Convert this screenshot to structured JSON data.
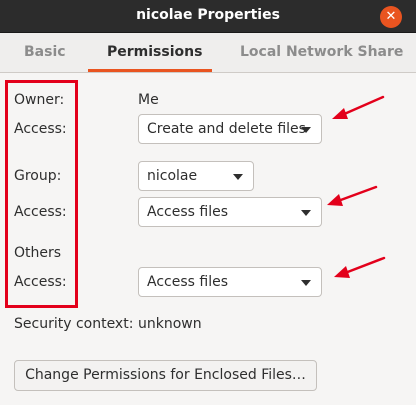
{
  "window": {
    "title": "nicolae Properties",
    "close_symbol": "✕"
  },
  "tabs": [
    {
      "label": "Basic",
      "active": false
    },
    {
      "label": "Permissions",
      "active": true
    },
    {
      "label": "Local Network Share",
      "active": false
    }
  ],
  "owner": {
    "label": "Owner:",
    "value": "Me",
    "access_label": "Access:",
    "access_value": "Create and delete files"
  },
  "group": {
    "label": "Group:",
    "value": "nicolae",
    "access_label": "Access:",
    "access_value": "Access files"
  },
  "others": {
    "label": "Others",
    "access_label": "Access:",
    "access_value": "Access files"
  },
  "security": {
    "label": "Security context:",
    "value": "unknown"
  },
  "enclosed_button": "Change Permissions for Enclosed Files…",
  "colors": {
    "accent": "#e95420",
    "annotation": "#e3001b",
    "titlebar": "#2c2c2c"
  }
}
